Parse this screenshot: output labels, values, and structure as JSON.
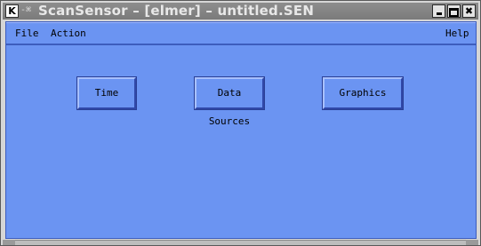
{
  "window": {
    "title": "ScanSensor – [elmer] – untitled.SEN",
    "logo_glyph": "K",
    "menu_glyph": "-⌘",
    "controls": {
      "minimize": "",
      "maximize": "",
      "close": "✖"
    }
  },
  "menubar": {
    "file": "File",
    "action": "Action",
    "help": "Help"
  },
  "buttons": {
    "time": "Time",
    "data_sources": "Data Sources",
    "graphics": "Graphics"
  },
  "colors": {
    "client_background": "#6b94f2",
    "titlebar": "#7b7b7b",
    "frame": "#d6d6d6"
  }
}
